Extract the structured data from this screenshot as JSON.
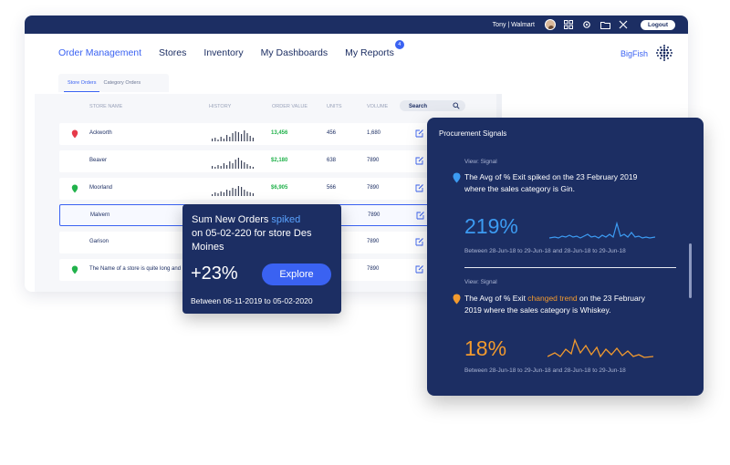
{
  "topbar": {
    "user": "Tony | Walmart",
    "logout": "Logout"
  },
  "nav": {
    "items": [
      "Order Management",
      "Stores",
      "Inventory",
      "My Dashboards",
      "My Reports"
    ],
    "reports_badge": "4",
    "brand": "BigFish"
  },
  "subtabs": [
    "Store Orders",
    "Category Orders"
  ],
  "table": {
    "headers": {
      "name": "STORE NAME",
      "history": "HISTORY",
      "order_value": "ORDER VALUE",
      "units": "UNITS",
      "volume": "VOLUME"
    },
    "search": "Search",
    "rows": [
      {
        "name": "Ackworth",
        "order_value": "13,456",
        "units": "456",
        "volume": "1,680",
        "pin": "red"
      },
      {
        "name": "Beaver",
        "order_value": "$2,180",
        "units": "638",
        "volume": "7890",
        "pin": ""
      },
      {
        "name": "Moorland",
        "order_value": "$6,905",
        "units": "566",
        "volume": "7890",
        "pin": "green"
      },
      {
        "name": "Malvern",
        "order_value": "",
        "units": "",
        "volume": "7890",
        "pin": ""
      },
      {
        "name": "Garison",
        "order_value": "",
        "units": "",
        "volume": "7890",
        "pin": ""
      },
      {
        "name": "The Name of a store is quite long and",
        "order_value": "",
        "units": "",
        "volume": "7890",
        "pin": "green"
      }
    ]
  },
  "popup": {
    "line1": "Sum New Orders ",
    "spiked": "spiked",
    "line2": "on 05-02-220 for store Des Moines",
    "change": "+23%",
    "explore": "Explore",
    "range": "Between 06-11-2019 to 05-02-2020"
  },
  "panel": {
    "title": "Procurement Signals",
    "signals": [
      {
        "view": "View: Signal",
        "text": "The Avg of % Exit spiked on the 23 February 2019 where the sales category is Gin.",
        "pct": "219%",
        "range": "Between 28-Jun-18 to 29-Jun-18 and 28-Jun-18 to 29-Jun-18"
      },
      {
        "view": "View: Signal",
        "text_before": "The Avg of % Exit ",
        "text_highlight": "changed trend",
        "text_after": " on the 23 February 2019 where the sales category is Whiskey.",
        "pct": "18%",
        "range": "Between 28-Jun-18 to 29-Jun-18 and 28-Jun-18 to 29-Jun-18"
      }
    ]
  },
  "colors": {
    "navy": "#1c2e63",
    "accent": "#3a62f2",
    "positive": "#21b24b",
    "signal_blue": "#3c9bf2",
    "signal_orange": "#f29a2e"
  }
}
